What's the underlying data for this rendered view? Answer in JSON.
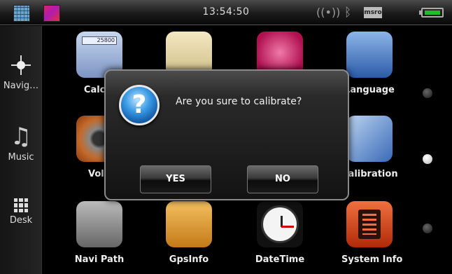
{
  "status_bar": {
    "time": "13:54:50",
    "icons": [
      "home-icon",
      "color-theme-icon",
      "signal-icon",
      "bluetooth-icon",
      "sd-card-icon",
      "battery-icon"
    ],
    "card_label": "msro"
  },
  "sidebar": {
    "items": [
      {
        "label": "Navig…",
        "icon": "compass-icon"
      },
      {
        "label": "Music",
        "icon": "music-note-icon"
      },
      {
        "label": "Desk",
        "icon": "desk-grid-icon"
      }
    ]
  },
  "apps": {
    "calculator": {
      "label": "Calcul",
      "screen": "25800"
    },
    "language": {
      "label": "Language"
    },
    "video": {
      "label": "Volu"
    },
    "calibration": {
      "label": "Calibration"
    },
    "navi_path": {
      "label": "Navi Path"
    },
    "gps_info": {
      "label": "GpsInfo"
    },
    "date_time": {
      "label": "DateTime"
    },
    "system_info": {
      "label": "System Info"
    }
  },
  "dialog": {
    "message": "Are you sure to calibrate?",
    "yes_label": "YES",
    "no_label": "NO",
    "icon": "question-icon"
  },
  "colors": {
    "accent_blue": "#3a9ae4",
    "battery_green": "#1fbf2b"
  }
}
